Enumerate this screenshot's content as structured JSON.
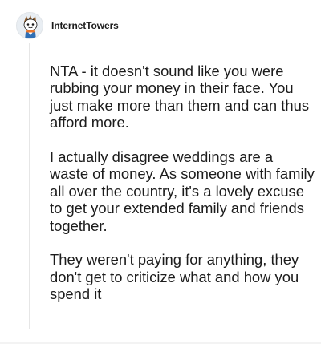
{
  "comment": {
    "username": "InternetTowers",
    "avatar_icon": "snoo-avatar-icon",
    "paragraphs": [
      "NTA - it doesn't sound like you were rubbing your money in their face. You just make more than them and can thus afford more.",
      "I actually disagree weddings are a waste of money. As someone with family all over the country, it's a lovely excuse to get your extended family and friends together.",
      "They weren't paying for anything, they don't get to criticize what and how you spend it"
    ]
  }
}
